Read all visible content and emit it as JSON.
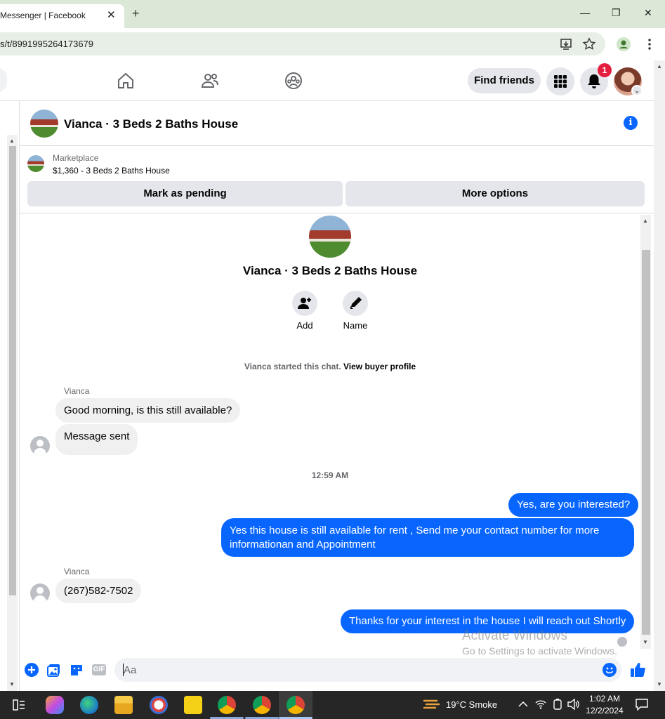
{
  "browser": {
    "tab_title": "Messenger | Facebook",
    "tab_close": "✕",
    "new_tab": "+",
    "url": "s/t/8991995264173679",
    "window_controls": [
      "—",
      "❐",
      "✕"
    ]
  },
  "nav": {
    "find_friends": "Find friends",
    "notification_count": "1"
  },
  "chat": {
    "title": "Vianca · 3 Beds 2 Baths House",
    "info_icon": "i",
    "marketplace_label": "Marketplace",
    "listing": "$1,360 - 3 Beds 2 Baths House",
    "mark_pending": "Mark as pending",
    "more_options": "More options",
    "profile_name": "Vianca · 3 Beds 2 Baths House",
    "add_label": "Add",
    "name_label": "Name",
    "system_msg": "Vianca started this chat.",
    "system_link": "View buyer profile"
  },
  "messages": {
    "sender1": "Vianca",
    "in1": "Good morning, is this still available?",
    "in2": "Message sent",
    "timestamp": "12:59 AM",
    "out1": "Yes, are you interested?",
    "out2": "Yes this house is still available for rent , Send me your contact number for more informationan and Appointment",
    "sender2": "Vianca",
    "in3": "(267)582-7502",
    "out3": "Thanks for your interest in the house I will reach out Shortly"
  },
  "composer": {
    "placeholder": "Aa",
    "gif_label": "GIF"
  },
  "watermark": {
    "line1": "Activate Windows",
    "line2": "Go to Settings to activate Windows."
  },
  "taskbar": {
    "weather": "19°C  Smoke",
    "time": "1:02 AM",
    "date": "12/2/2024"
  },
  "colors": {
    "accent": "#0866ff",
    "badge": "#e41e3f",
    "bubble_in": "#f0f0f0",
    "chrome_frame": "#dbe8d7"
  }
}
